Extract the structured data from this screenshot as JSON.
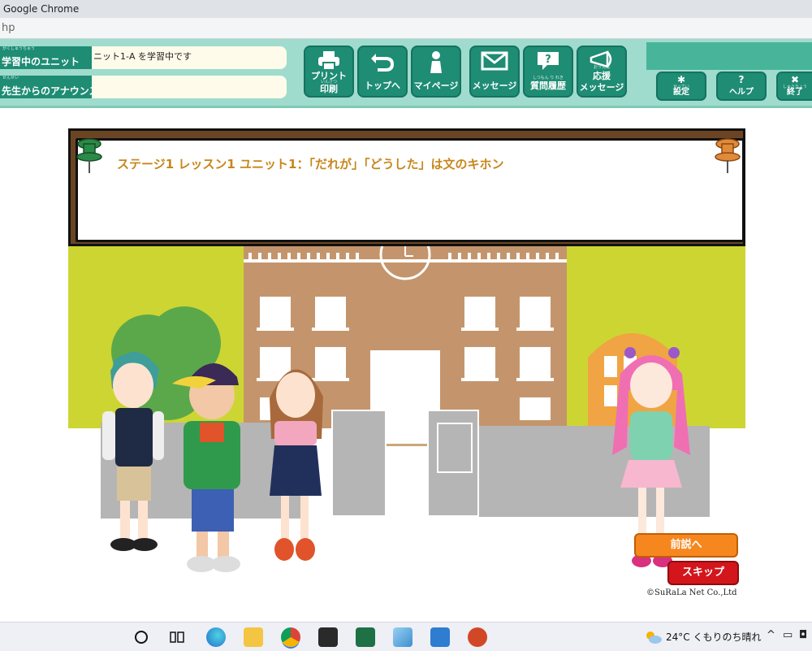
{
  "window": {
    "title": "Google Chrome",
    "url_fragment": "hp"
  },
  "header": {
    "unit_label": "学習中のユニット",
    "unit_label_ruby": "がくしゅうちゅう",
    "unit_value": "ニット1-A を学習中です",
    "announce_label": "先生からのアナウンス",
    "announce_label_ruby": "せんせい",
    "announce_value": "",
    "nav": {
      "print_label_1": "プリント",
      "print_ruby": "いんさつ",
      "print_label_2": "印刷",
      "top_label": "トップへ",
      "mypage_label": "マイページ",
      "message_label": "メッセージ",
      "history_ruby": "しつもん り れき",
      "history_label": "質問履歴",
      "cheer_ruby": "おうえん",
      "cheer_label_1": "応援",
      "cheer_label_2": "メッセージ"
    },
    "settings_ruby": "せってい",
    "settings_label": "設定",
    "help_label": "ヘルプ",
    "exit_ruby": "しゅうりょう",
    "exit_label": "終了"
  },
  "lesson": {
    "title": "ステージ1 レッスン1 ユニット1：「だれが」「どうした」は文のキホン",
    "prev_button": "前説へ",
    "skip_button": "スキップ",
    "copyright": "©SuRaLa Net Co.,Ltd"
  },
  "taskbar": {
    "weather": "24°C くもりのち晴れ",
    "tray_icons": [
      "chevron-up-icon",
      "display-icon",
      "camera-icon"
    ]
  },
  "colors": {
    "header_bg": "#9fdccd",
    "button_green": "#1f8c74",
    "title_orange": "#c7861b",
    "yard": "#cdd533",
    "school": "#c4956c",
    "prev_button": "#f6871f",
    "skip_button": "#d3161b"
  }
}
